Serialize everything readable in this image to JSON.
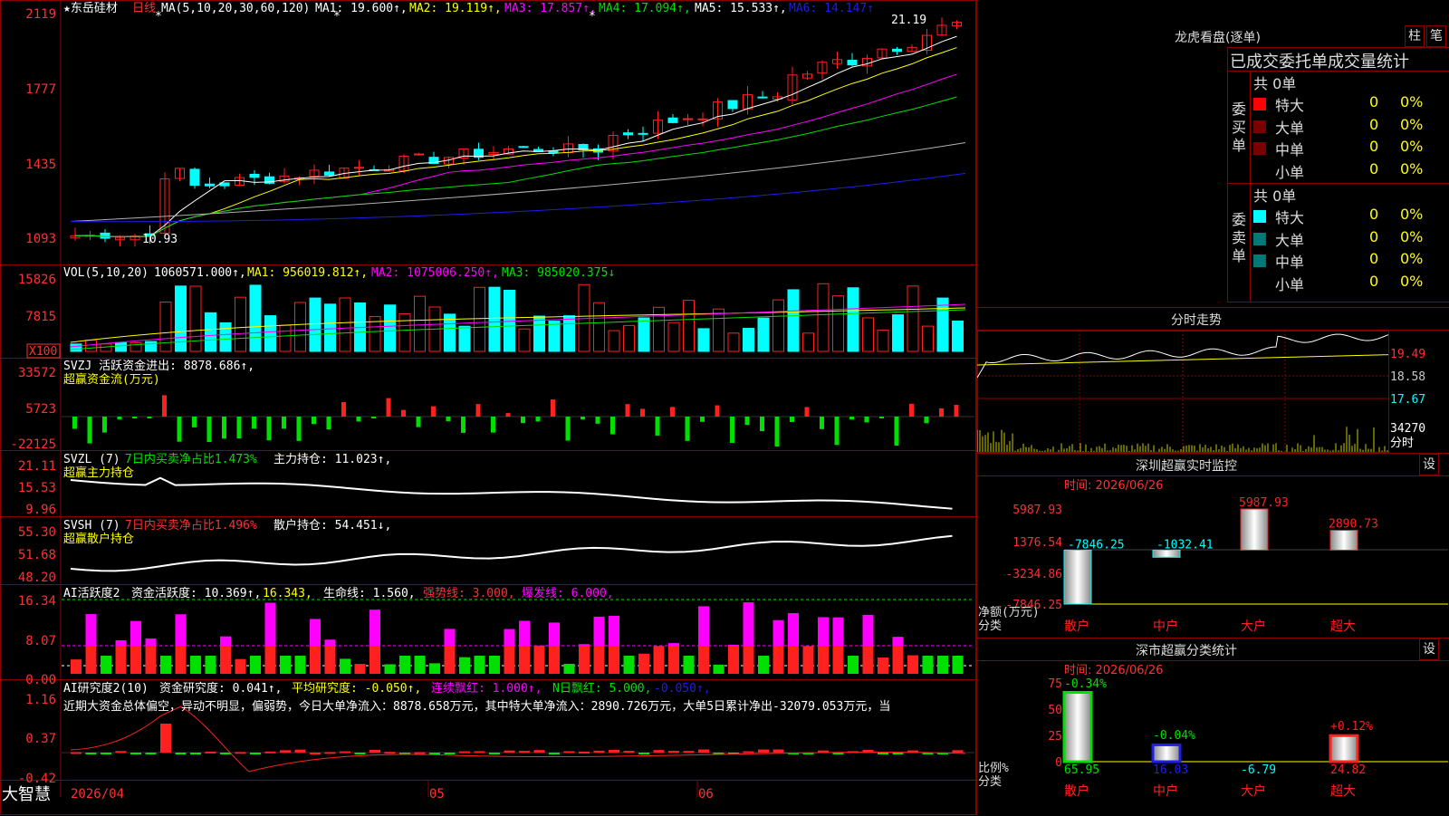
{
  "stock": {
    "name": "★东岳硅材",
    "period": "日线"
  },
  "colors": {
    "up": "#ff2020",
    "down": "#00ffff",
    "green": "#00e000",
    "magenta": "#ff00ff",
    "yellow": "#ffff00",
    "white": "#ffffff",
    "frame": "#8a0000",
    "axis_red": "#ff3030",
    "blue": "#1e1ee6",
    "gray": "#b0b0b0"
  },
  "main": {
    "ma_header": "MA(5,10,20,30,60,120)",
    "ma1": "MA1: 19.600↑,",
    "ma2": "MA2: 19.119↑,",
    "ma3": "MA3: 17.857↑,",
    "ma4": "MA4: 17.094↑,",
    "ma5": "MA5: 15.533↑,",
    "ma6": "MA6: 14.147↑",
    "y_ticks": [
      "2119",
      "1777",
      "1435",
      "1093"
    ],
    "high_label": "21.19",
    "low_label": "10.93"
  },
  "vol": {
    "header": "VOL(5,10,20)",
    "value": "1060571.000↑,",
    "ma1": "MA1: 956019.812↑,",
    "ma2": "MA2: 1075006.250↑,",
    "ma3": "MA3: 985020.375↓",
    "y_ticks": [
      "15826",
      "7815"
    ],
    "unit": "X100"
  },
  "svzj": {
    "header": "SVZJ  活跃资金进出: 8878.686↑,",
    "subtitle": "超赢资金流(万元)",
    "y_ticks": [
      "33572",
      "5723",
      "-22125"
    ]
  },
  "svzl": {
    "header": "SVZL (7)",
    "h2": "7日内买卖净占比1.473%",
    "h3": "主力持仓: 11.023↑,",
    "subtitle": "超赢主力持仓",
    "y_ticks": [
      "21.11",
      "15.53",
      "9.96"
    ]
  },
  "svsh": {
    "header": "SVSH (7)",
    "h2": "7日内买卖净占比1.496%",
    "h3": "散户持仓: 54.451↓,",
    "subtitle": "超赢散户持仓",
    "y_ticks": [
      "55.30",
      "51.68",
      "48.20"
    ]
  },
  "ai2": {
    "header": "AI活跃度2",
    "h1": "资金活跃度: 10.369↑,",
    "h2": "16.343,",
    "h3": "生命线: 1.560,",
    "h4": "强势线: 3.000,",
    "h5": "爆发线: 6.000,",
    "y_ticks": [
      "16.34",
      "8.07",
      "0.00"
    ]
  },
  "ai_research": {
    "header": "AI研究度2(10)",
    "h1": "资金研究度: 0.041↑,",
    "h2": "平均研究度: -0.050↑,",
    "h3": "连续飘红: 1.000↑,",
    "h4": "N日飘红: 5.000,",
    "h5": "-0.050↑,",
    "commentary": "近期大资金总体偏空，异动不明显，偏弱势，今日大单净流入：8878.658万元，其中特大单净流入：2890.726万元，大单5日累计净出-32079.053万元，当",
    "y_ticks": [
      "1.16",
      "0.37",
      "-0.42"
    ]
  },
  "bottom": {
    "brand": "大智慧",
    "dates": [
      "2026/04",
      "05",
      "06"
    ]
  },
  "longhu": {
    "title": "龙虎看盘(逐单)",
    "btn1": "柱",
    "btn2": "笔",
    "tabs": "已成交委托单成交量统计",
    "buy_label": "委买单",
    "sell_label": "委卖单",
    "buy_total": "共 0单",
    "sell_total": "共 0单",
    "rows": [
      {
        "label": "特大",
        "n": "0",
        "p": "0%"
      },
      {
        "label": "大单",
        "n": "0",
        "p": "0%"
      },
      {
        "label": "中单",
        "n": "0",
        "p": "0%"
      },
      {
        "label": "小单",
        "n": "0",
        "p": "0%"
      }
    ]
  },
  "intraday": {
    "title": "分时走势",
    "prices": [
      "19.49",
      "18.58",
      "17.67"
    ],
    "vol": "34270",
    "unit": "分时"
  },
  "monitor": {
    "title": "深圳超赢实时监控",
    "btn": "设",
    "date": "时间: 2026/06/26",
    "y_ticks": [
      "5987.93",
      "1376.54",
      "-3234.86",
      "-7846.25"
    ],
    "ylabel": "净额(万元)",
    "xlabel": "分类",
    "cats": [
      "散户",
      "中户",
      "大户",
      "超大"
    ],
    "values": [
      "-7846.25",
      "-1032.41",
      "5987.93",
      "2890.73"
    ]
  },
  "classify": {
    "title": "深市超赢分类统计",
    "btn": "设",
    "date": "时间: 2026/06/26",
    "y_ticks": [
      "75",
      "50",
      "25",
      "0"
    ],
    "ylabel": "比例%",
    "xlabel": "分类",
    "cats": [
      "散户",
      "中户",
      "大户",
      "超大"
    ],
    "pct_labels": [
      "-0.34%",
      "-0.04%",
      "+0.12%"
    ],
    "bottom_vals": [
      "65.95",
      "16.03",
      "-6.79",
      "24.82"
    ]
  }
}
